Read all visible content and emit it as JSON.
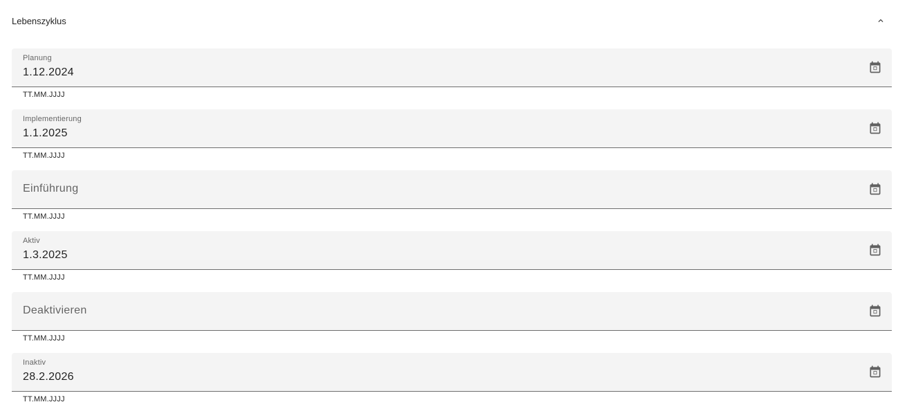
{
  "panel": {
    "title": "Lebenszyklus",
    "collapse_icon": "chevron-up-icon"
  },
  "fields": [
    {
      "label": "Planung",
      "value": "1.12.2024",
      "hint": "TT.MM.JJJJ",
      "icon": "calendar-icon"
    },
    {
      "label": "Implementierung",
      "value": "1.1.2025",
      "hint": "TT.MM.JJJJ",
      "icon": "calendar-icon"
    },
    {
      "label": "Einführung",
      "value": "",
      "hint": "TT.MM.JJJJ",
      "icon": "calendar-icon"
    },
    {
      "label": "Aktiv",
      "value": "1.3.2025",
      "hint": "TT.MM.JJJJ",
      "icon": "calendar-icon"
    },
    {
      "label": "Deaktivieren",
      "value": "",
      "hint": "TT.MM.JJJJ",
      "icon": "calendar-icon"
    },
    {
      "label": "Inaktiv",
      "value": "28.2.2026",
      "hint": "TT.MM.JJJJ",
      "icon": "calendar-icon"
    }
  ],
  "colors": {
    "field_background": "#f4f4f4",
    "icon": "#616161"
  }
}
